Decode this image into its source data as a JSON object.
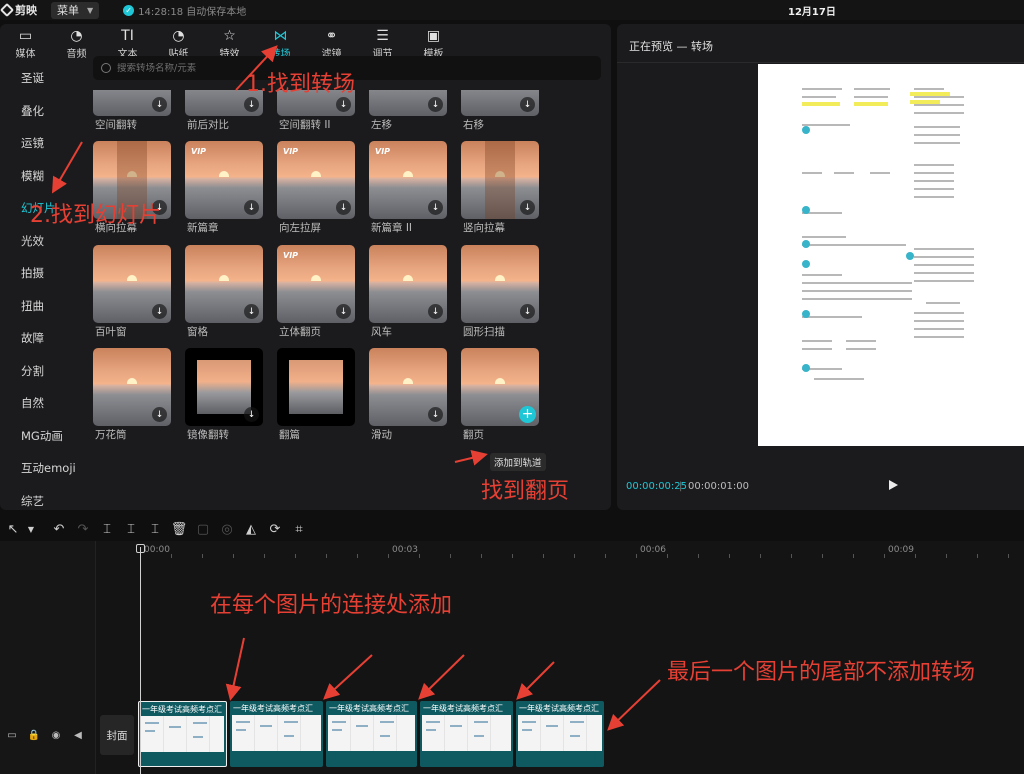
{
  "app": {
    "name": "剪映",
    "menu_label": "菜单",
    "save_status": "14:28:18 自动保存本地",
    "date": "12月17日"
  },
  "tabs": [
    {
      "label": "媒体",
      "icon": "media-icon",
      "glyph": "▭"
    },
    {
      "label": "音频",
      "icon": "audio-icon",
      "glyph": "◔"
    },
    {
      "label": "文本",
      "icon": "text-icon",
      "glyph": "TI"
    },
    {
      "label": "贴纸",
      "icon": "sticker-icon",
      "glyph": "◔"
    },
    {
      "label": "特效",
      "icon": "effects-icon",
      "glyph": "☆"
    },
    {
      "label": "转场",
      "icon": "transition-icon",
      "glyph": "⋈"
    },
    {
      "label": "滤镜",
      "icon": "filter-icon",
      "glyph": "⚭"
    },
    {
      "label": "调节",
      "icon": "adjust-icon",
      "glyph": "☰"
    },
    {
      "label": "模板",
      "icon": "template-icon",
      "glyph": "▣"
    }
  ],
  "active_tab": "转场",
  "sidebar": {
    "items": [
      "圣诞",
      "叠化",
      "运镜",
      "模糊",
      "幻灯片",
      "光效",
      "拍摄",
      "扭曲",
      "故障",
      "分割",
      "自然",
      "MG动画",
      "互动emoji",
      "综艺"
    ],
    "active": "幻灯片"
  },
  "search": {
    "placeholder": "搜索转场名称/元素"
  },
  "transitions": [
    {
      "label": "空间翻转",
      "vip": false
    },
    {
      "label": "前后对比",
      "vip": false
    },
    {
      "label": "空间翻转 II",
      "vip": false
    },
    {
      "label": "左移",
      "vip": false
    },
    {
      "label": "右移",
      "vip": false
    },
    {
      "label": "横向拉幕",
      "vip": false
    },
    {
      "label": "新篇章",
      "vip": true
    },
    {
      "label": "向左拉屏",
      "vip": true
    },
    {
      "label": "新篇章 II",
      "vip": true
    },
    {
      "label": "竖向拉幕",
      "vip": false
    },
    {
      "label": "百叶窗",
      "vip": false
    },
    {
      "label": "窗格",
      "vip": false
    },
    {
      "label": "立体翻页",
      "vip": true
    },
    {
      "label": "风车",
      "vip": false
    },
    {
      "label": "圆形扫描",
      "vip": false
    },
    {
      "label": "万花筒",
      "vip": false
    },
    {
      "label": "镜像翻转",
      "vip": false
    },
    {
      "label": "翻篇",
      "vip": false
    },
    {
      "label": "滑动",
      "vip": false
    },
    {
      "label": "翻页",
      "vip": false
    }
  ],
  "vip_badge": "VIP",
  "tooltip": "添加到轨道",
  "preview": {
    "title": "正在预览 — 转场",
    "current_time": "00:00:00:25",
    "separator": "|",
    "total_time": "00:00:01:00"
  },
  "timeline": {
    "ruler": [
      "00:00",
      "00:03",
      "00:06",
      "00:09"
    ],
    "cover_label": "封面",
    "clips": [
      "一年级考试高频考点汇",
      "一年级考试高频考点汇",
      "一年级考试高频考点汇",
      "一年级考试高频考点汇",
      "一年级考试高频考点汇"
    ]
  },
  "annotations": {
    "a1": "1.找到转场",
    "a2": "2.找到幻灯片",
    "a3": "找到翻页",
    "a4": "在每个图片的连接处添加",
    "a5": "最后一个图片的尾部不添加转场"
  },
  "colors": {
    "accent": "#1fc7d6",
    "annotation": "#e64034",
    "clip": "#0f5a61"
  }
}
